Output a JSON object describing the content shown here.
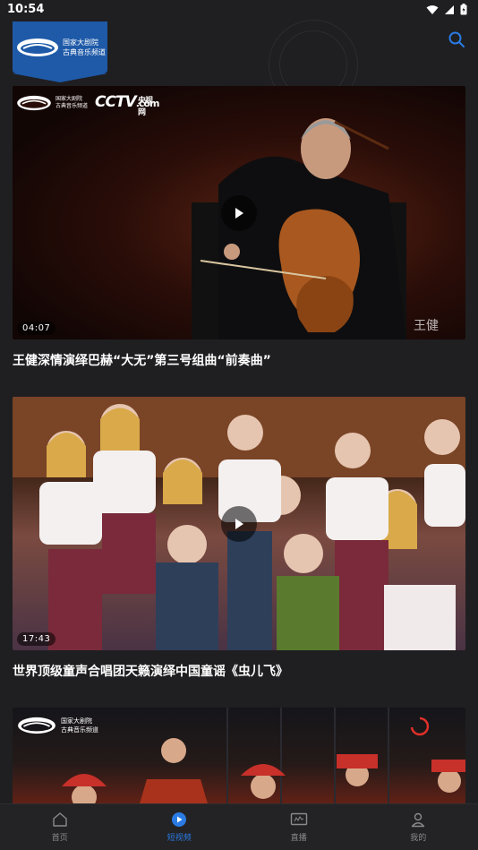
{
  "status_bar": {
    "time": "10:54"
  },
  "header": {
    "logo_line1": "国家大剧院",
    "logo_line2": "古典音乐频道"
  },
  "videos": [
    {
      "title": "王健深情演绎巴赫“大无”第三号组曲“前奏曲”",
      "duration": "04:07",
      "watermark_line1": "国家大剧院",
      "watermark_line2": "古典音乐频道",
      "cctv_text": "CCTV",
      "cctv_suffix": "央视网",
      "cctv_domain": ".com",
      "signature": "王健"
    },
    {
      "title": "世界顶级童声合唱团天籁演绎中国童谣《虫儿飞》",
      "duration": "17:43"
    },
    {
      "watermark_line1": "国家大剧院",
      "watermark_line2": "古典音乐频道"
    }
  ],
  "bottom_nav": {
    "items": [
      {
        "label": "首页",
        "active": false
      },
      {
        "label": "短视频",
        "active": true
      },
      {
        "label": "直播",
        "active": false
      },
      {
        "label": "我的",
        "active": false
      }
    ]
  },
  "colors": {
    "accent": "#2a7be4",
    "logo_blue": "#1e5aa8",
    "background": "#1f1f21"
  }
}
